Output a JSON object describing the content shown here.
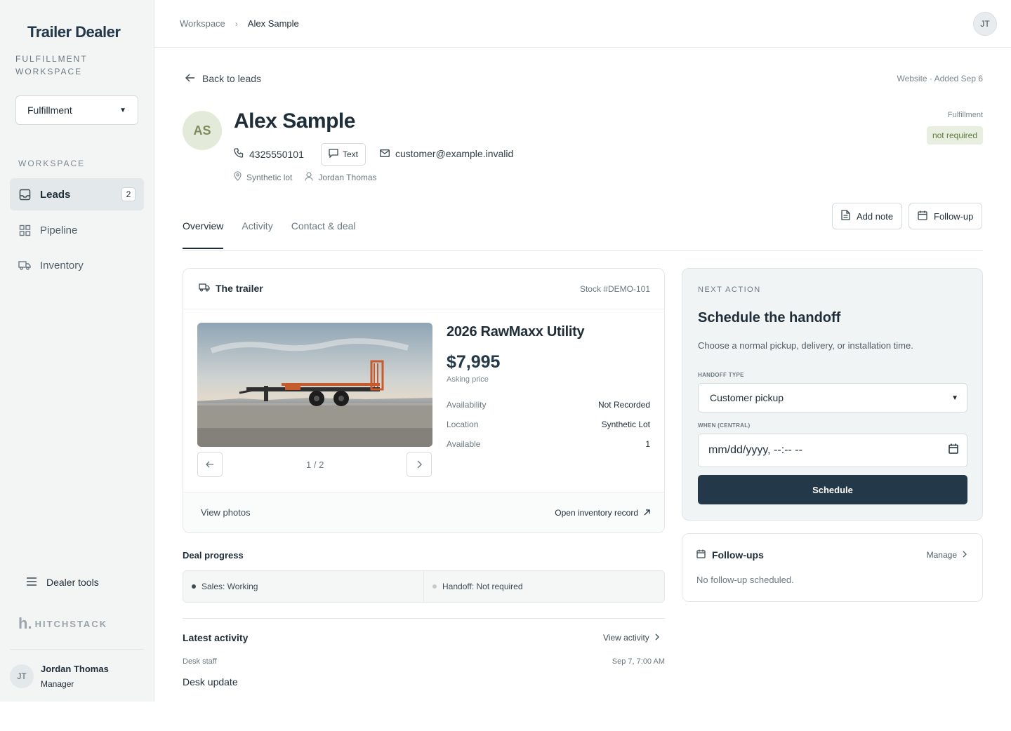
{
  "sidebar": {
    "brand": "Trailer Dealer",
    "subtitle": "FULFILLMENT WORKSPACE",
    "workspace_select": "Fulfillment",
    "nav_heading": "WORKSPACE",
    "nav": [
      {
        "label": "Leads",
        "icon": "inbox-icon",
        "badge": "2",
        "active": true
      },
      {
        "label": "Pipeline",
        "icon": "grid-icon",
        "active": false
      },
      {
        "label": "Inventory",
        "icon": "truck-icon",
        "active": false
      }
    ],
    "dealer_tools": "Dealer tools",
    "company": "HITCHSTACK",
    "user": {
      "initials": "JT",
      "name": "Jordan Thomas",
      "role": "Manager"
    }
  },
  "topbar": {
    "breadcrumb": [
      "Workspace",
      "Alex Sample"
    ],
    "avatar_initials": "JT"
  },
  "lead": {
    "back_label": "Back to leads",
    "source": "Website · Added Sep 6",
    "initials": "AS",
    "name": "Alex Sample",
    "phone": "4325550101",
    "text_label": "Text",
    "email": "customer@example.invalid",
    "location": "Synthetic lot",
    "owner": "Jordan Thomas",
    "fulfillment_label": "Fulfillment",
    "fulfillment_status": "not required"
  },
  "tabs": [
    "Overview",
    "Activity",
    "Contact & deal"
  ],
  "actions": {
    "add_note": "Add note",
    "follow_up": "Follow-up"
  },
  "trailer": {
    "heading": "The trailer",
    "stock": "Stock #DEMO-101",
    "model": "2026 RawMaxx Utility",
    "price": "$7,995",
    "price_label": "Asking price",
    "specs": [
      {
        "k": "Availability",
        "v": "Not Recorded"
      },
      {
        "k": "Location",
        "v": "Synthetic Lot"
      },
      {
        "k": "Available",
        "v": "1"
      }
    ],
    "pager": "1 / 2",
    "view_photos": "View photos",
    "open_inventory": "Open inventory record"
  },
  "deal_progress": {
    "title": "Deal progress",
    "steps": [
      {
        "label": "Sales: Working",
        "color": "#3c4a52"
      },
      {
        "label": "Handoff: Not required",
        "color": "#c4cacd"
      }
    ]
  },
  "latest_activity": {
    "title": "Latest activity",
    "link": "View activity",
    "who": "Desk staff",
    "when": "Sep 7, 7:00 AM",
    "text": "Desk update"
  },
  "next_action": {
    "label": "NEXT ACTION",
    "title": "Schedule the handoff",
    "description": "Choose a normal pickup, delivery, or installation time.",
    "handoff_type_label": "HANDOFF TYPE",
    "handoff_type_value": "Customer pickup",
    "when_label": "WHEN (CENTRAL)",
    "when_placeholder": "mm/dd/yyyy, --:-- --",
    "schedule_label": "Schedule"
  },
  "followups": {
    "title": "Follow-ups",
    "manage": "Manage",
    "empty": "No follow-up scheduled."
  }
}
